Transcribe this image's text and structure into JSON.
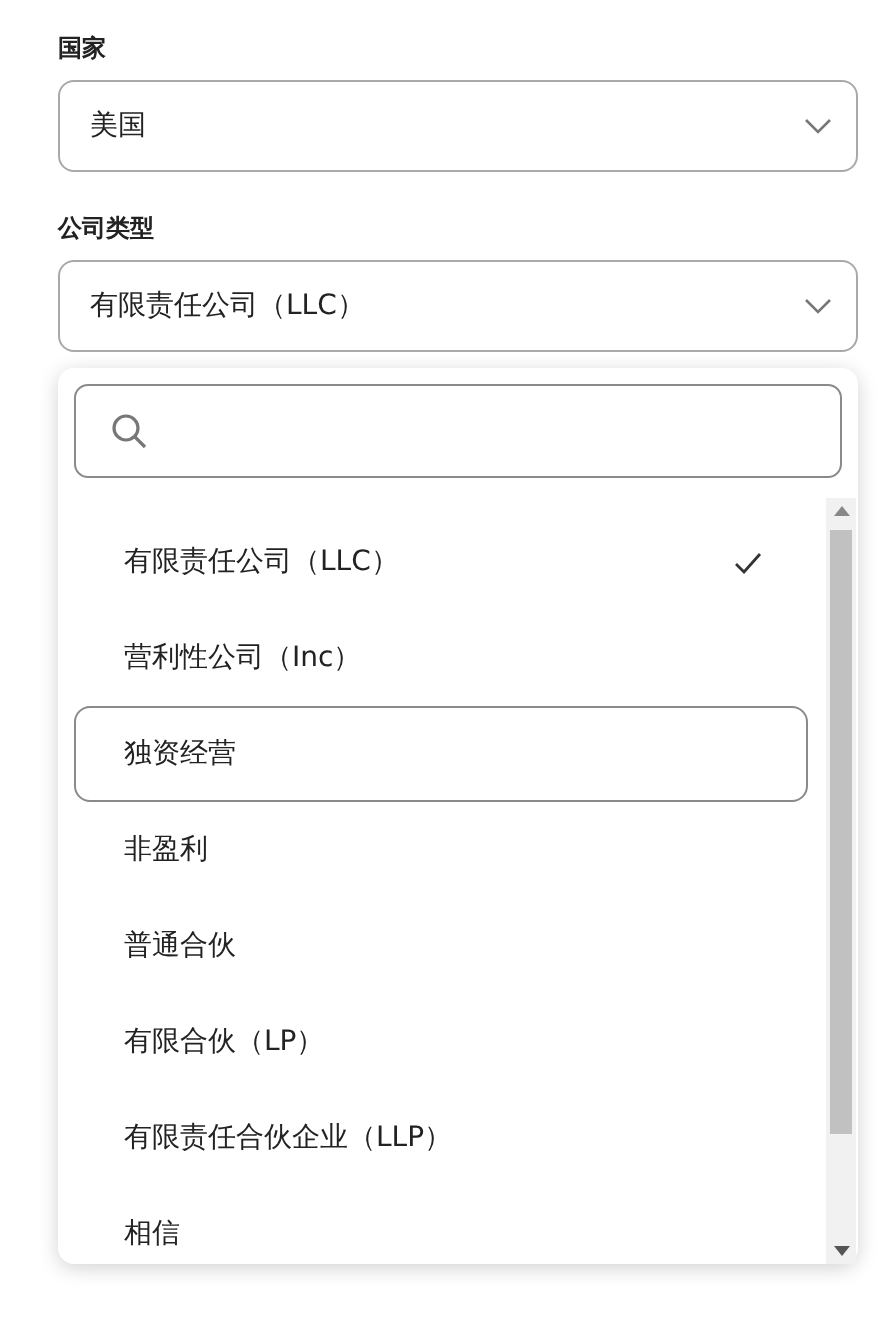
{
  "fields": [
    {
      "label": "国家",
      "value": "美国"
    },
    {
      "label": "公司类型",
      "value": "有限责任公司（LLC）",
      "dropdown": {
        "options": [
          {
            "label": "有限责任公司（LLC）",
            "selected": true,
            "highlighted": false
          },
          {
            "label": "营利性公司（Inc）",
            "selected": false,
            "highlighted": false
          },
          {
            "label": "独资经营",
            "selected": false,
            "highlighted": true
          },
          {
            "label": "非盈利",
            "selected": false,
            "highlighted": false
          },
          {
            "label": "普通合伙",
            "selected": false,
            "highlighted": false
          },
          {
            "label": "有限合伙（LP）",
            "selected": false,
            "highlighted": false
          },
          {
            "label": "有限责任合伙企业（LLP）",
            "selected": false,
            "highlighted": false
          },
          {
            "label": "相信",
            "selected": false,
            "highlighted": false
          }
        ]
      }
    }
  ]
}
